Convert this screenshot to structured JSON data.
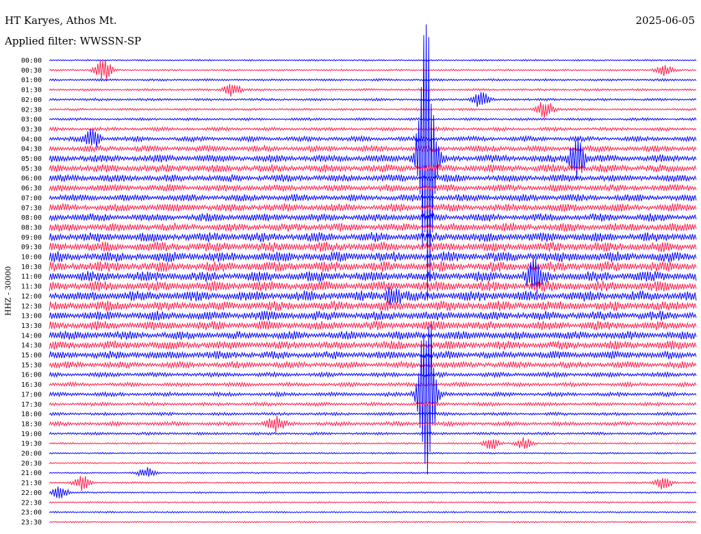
{
  "header": {
    "station": "HT Karyes, Athos Mt.",
    "date": "2025-06-05",
    "filter": "Applied filter: WWSSN-SP"
  },
  "colors": {
    "trace_a": "#0000ff",
    "trace_b": "#ff1a4a",
    "background": "#ffffff",
    "text": "#000000"
  },
  "chart_data": {
    "type": "line",
    "title": "HT Karyes, Athos Mt.",
    "subtitle": "Applied filter: WWSSN-SP",
    "date": "2025-06-05",
    "ylabel": "HHZ - 30000",
    "xlabel": "",
    "rows": [
      "00:00",
      "00:30",
      "01:00",
      "01:30",
      "02:00",
      "02:30",
      "03:00",
      "03:30",
      "04:00",
      "04:30",
      "05:00",
      "05:30",
      "06:00",
      "06:30",
      "07:00",
      "07:30",
      "08:00",
      "08:30",
      "09:00",
      "09:30",
      "10:00",
      "10:30",
      "11:00",
      "11:30",
      "12:00",
      "12:30",
      "13:00",
      "13:30",
      "14:00",
      "14:30",
      "15:00",
      "15:30",
      "16:00",
      "16:30",
      "17:00",
      "17:30",
      "18:00",
      "18:30",
      "19:00",
      "19:30",
      "20:00",
      "20:30",
      "21:00",
      "21:30",
      "22:00",
      "22:30",
      "23:00",
      "23:30"
    ],
    "row_minutes": 30,
    "color_cycle": [
      "#0000ff",
      "#ff1a4a"
    ],
    "noise_level": [
      0.08,
      0.1,
      0.15,
      0.15,
      0.18,
      0.15,
      0.2,
      0.3,
      0.45,
      0.55,
      0.7,
      0.75,
      0.7,
      0.65,
      0.65,
      0.75,
      0.75,
      0.8,
      0.9,
      0.95,
      1.0,
      1.0,
      1.0,
      1.0,
      1.0,
      0.95,
      0.9,
      0.85,
      0.8,
      0.8,
      0.75,
      0.6,
      0.4,
      0.35,
      0.35,
      0.3,
      0.25,
      0.35,
      0.2,
      0.1,
      0.08,
      0.08,
      0.08,
      0.08,
      0.08,
      0.08,
      0.08,
      0.08
    ],
    "events": [
      {
        "row": 1,
        "minute": 2.5,
        "amplitude": 2.5
      },
      {
        "row": 1,
        "minute": 28.5,
        "amplitude": 1.2
      },
      {
        "row": 3,
        "minute": 8.5,
        "amplitude": 1.5
      },
      {
        "row": 4,
        "minute": 20.0,
        "amplitude": 1.6
      },
      {
        "row": 5,
        "minute": 23.0,
        "amplitude": 2.0
      },
      {
        "row": 8,
        "minute": 2.0,
        "amplitude": 1.8
      },
      {
        "row": 10,
        "minute": 17.5,
        "amplitude": 30.0
      },
      {
        "row": 10,
        "minute": 24.5,
        "amplitude": 4.0
      },
      {
        "row": 22,
        "minute": 22.5,
        "amplitude": 3.0
      },
      {
        "row": 24,
        "minute": 16.0,
        "amplitude": 2.0
      },
      {
        "row": 34,
        "minute": 17.5,
        "amplitude": 20.0
      },
      {
        "row": 37,
        "minute": 10.5,
        "amplitude": 1.5
      },
      {
        "row": 39,
        "minute": 20.5,
        "amplitude": 1.2
      },
      {
        "row": 39,
        "minute": 22.0,
        "amplitude": 1.2
      },
      {
        "row": 42,
        "minute": 4.5,
        "amplitude": 1.0
      },
      {
        "row": 43,
        "minute": 1.5,
        "amplitude": 1.5
      },
      {
        "row": 43,
        "minute": 28.5,
        "amplitude": 1.5
      },
      {
        "row": 44,
        "minute": 0.5,
        "amplitude": 1.2
      }
    ],
    "grid": false,
    "legend": "none"
  }
}
